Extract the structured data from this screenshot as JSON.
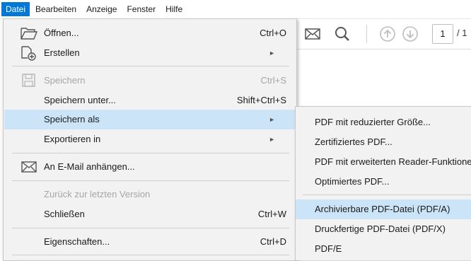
{
  "menubar": {
    "items": [
      "Datei",
      "Bearbeiten",
      "Anzeige",
      "Fenster",
      "Hilfe"
    ]
  },
  "toolbar": {
    "icons": [
      "mail-icon",
      "search-icon",
      "arrow-up-icon",
      "arrow-down-icon"
    ],
    "page_number": "1",
    "page_total": "/ 1"
  },
  "file_menu": {
    "items": [
      {
        "label": "Öffnen...",
        "shortcut": "Ctrl+O",
        "icon": "folder-open-icon"
      },
      {
        "label": "Erstellen",
        "icon": "create-pdf-icon"
      },
      {
        "label": "Speichern",
        "shortcut": "Ctrl+S",
        "icon": "save-icon"
      },
      {
        "label": "Speichern unter...",
        "shortcut": "Shift+Ctrl+S"
      },
      {
        "label": "Speichern als"
      },
      {
        "label": "Exportieren in"
      },
      {
        "label": "An E-Mail anhängen...",
        "icon": "mail-icon"
      },
      {
        "label": "Zurück zur letzten Version"
      },
      {
        "label": "Schließen",
        "shortcut": "Ctrl+W"
      },
      {
        "label": "Eigenschaften...",
        "shortcut": "Ctrl+D"
      }
    ]
  },
  "save_as_submenu": {
    "items": [
      "PDF mit reduzierter Größe...",
      "Zertifiziertes PDF...",
      "PDF mit erweiterten Reader-Funktionen",
      "Optimiertes PDF...",
      "Archivierbare PDF-Datei (PDF/A)",
      "Druckfertige PDF-Datei (PDF/X)",
      "PDF/E"
    ]
  },
  "colors": {
    "accent": "#0078d7",
    "highlight": "#cce4f7",
    "menu_bg": "#f2f2f2",
    "disabled_text": "#a6a6a6"
  }
}
